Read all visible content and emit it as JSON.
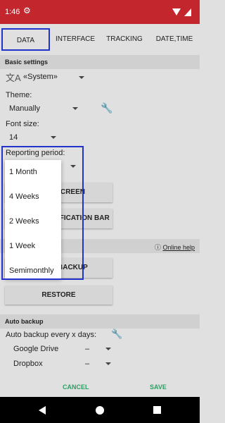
{
  "status_bar": {
    "time": "1:46"
  },
  "tabs": [
    {
      "label": "DATA"
    },
    {
      "label": "INTERFACE"
    },
    {
      "label": "TRACKING"
    },
    {
      "label": "DATE,TIME"
    }
  ],
  "basic_settings": {
    "header": "Basic settings",
    "language_value": "«System»",
    "theme_label": "Theme:",
    "theme_value": "Manually",
    "font_size_label": "Font size:",
    "font_size_value": "14",
    "reporting_period_label": "Reporting period:"
  },
  "behind_popup": {
    "screen_button_fragment": "CREEN",
    "notification_bar_button_fragment": "IFICATION BAR",
    "online_help": "Online help",
    "backup_button_fragment": "BACKUP"
  },
  "restore_button": "RESTORE",
  "auto_backup": {
    "header": "Auto backup",
    "label": "Auto backup every x days:",
    "google_drive_label": "Google Drive",
    "google_drive_value": "–",
    "dropbox_label": "Dropbox",
    "dropbox_value": "–"
  },
  "popup_options": [
    "1 Month",
    "4 Weeks",
    "2 Weeks",
    "1 Week",
    "Semimonthly"
  ],
  "footer": {
    "cancel": "CANCEL",
    "save": "SAVE"
  },
  "colors": {
    "status_bar": "#c4262e",
    "highlight": "#2233cc",
    "footer_text": "#2a9f62"
  }
}
